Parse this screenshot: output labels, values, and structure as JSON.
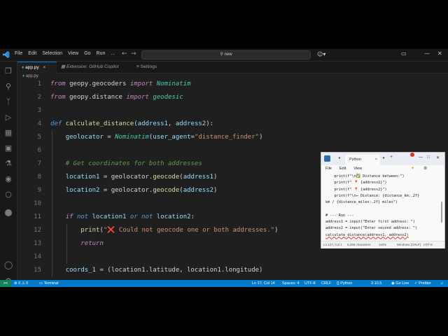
{
  "menu": [
    "File",
    "Edit",
    "Selection",
    "View",
    "Go",
    "Run",
    "..."
  ],
  "search": {
    "value": "new"
  },
  "tabs": [
    {
      "label": "app.py",
      "active": true
    },
    {
      "label": "Extension: GitHub Copilot",
      "active": false
    },
    {
      "label": "Settings",
      "active": false
    }
  ],
  "breadcrumb": "app.py",
  "code_lines": [
    {
      "n": "1",
      "html": "<span class='kw'>from</span> geopy.geocoders <span class='kw'>import</span> <span class='cls'>Nominatim</span>"
    },
    {
      "n": "2",
      "html": "<span class='kw'>from</span> geopy.distance <span class='kw'>import</span> <span class='cls'>geodesic</span>"
    },
    {
      "n": "3",
      "html": ""
    },
    {
      "n": "4",
      "html": "<span class='kw2'>def</span> <span class='fn'>calculate_distance</span>(<span class='var'>address1</span>, <span class='var'>address2</span>):"
    },
    {
      "n": "5",
      "html": "    <span class='var'>geolocator</span> = <span class='cls'>Nominatim</span>(<span class='var'>user_agent</span>=<span class='str'>\"distance_finder\"</span>)"
    },
    {
      "n": "6",
      "html": ""
    },
    {
      "n": "7",
      "html": "    <span class='cmt'># Get coordinates for both addresses</span>"
    },
    {
      "n": "8",
      "html": "    <span class='var'>location1</span> = geolocator.<span class='fn'>geocode</span>(<span class='var'>address1</span>)"
    },
    {
      "n": "9",
      "html": "    <span class='var'>location2</span> = geolocator.<span class='fn'>geocode</span>(<span class='var'>address2</span>)"
    },
    {
      "n": "10",
      "html": ""
    },
    {
      "n": "11",
      "html": "    <span class='kw'>if</span> <span class='kw2'>not</span> <span class='var'>location1</span> <span class='kw2'>or</span> <span class='kw2'>not</span> <span class='var'>location2</span>:"
    },
    {
      "n": "12",
      "html": "        <span class='fn'>print</span>(<span class='str'>\"<span style='color:#f14c4c'>&#10060;</span> Could not geocode one or both addresses.\"</span>)"
    },
    {
      "n": "13",
      "html": "        <span class='kw'>return</span>"
    },
    {
      "n": "14",
      "html": ""
    },
    {
      "n": "15",
      "html": "    <span class='var'>coords_1</span> = (location1.latitude, location1.longitude)"
    }
  ],
  "statusbar": {
    "remote": "&gt;&lt;",
    "problems": "⊗ 0 ⚠ 0",
    "terminal": "Terminal",
    "cursor": "Ln 27, Col 14",
    "spaces": "Spaces: 4",
    "encoding": "UTF-8",
    "eol": "CRLF",
    "language": "{} Python",
    "version": "3.10.5",
    "golive": "◉ Go Live",
    "prettier": "✓ Prettier"
  },
  "notepad": {
    "tab": "Python",
    "menu": [
      "File",
      "Edit",
      "View"
    ],
    "lines": [
      "    print(f\"\\n✅ Distance between:\")",
      "    print(f\" 📍 {address1}\")",
      "    print(f\" 📍 {address2}\")",
      "    print(f\"\\n↔ Distance: {distance_km:.2f}",
      "km / {distance_miles:.2f} miles\")",
      "",
      "# --- Run ---",
      "address1 = input(\"Enter first address: \")",
      "address2 = input(\"Enter second address: \")",
      "calculate_distance(address1, address2)"
    ],
    "status": {
      "pos": "Ln 127, Col 1",
      "chars": "6,268 characters",
      "zoom": "110%",
      "eol": "Windows (CRLF)",
      "enc": "UTF-8"
    }
  },
  "colors": {
    "accent": "#007acc",
    "editor_bg": "#1f1f1f",
    "remote": "#16825d"
  }
}
